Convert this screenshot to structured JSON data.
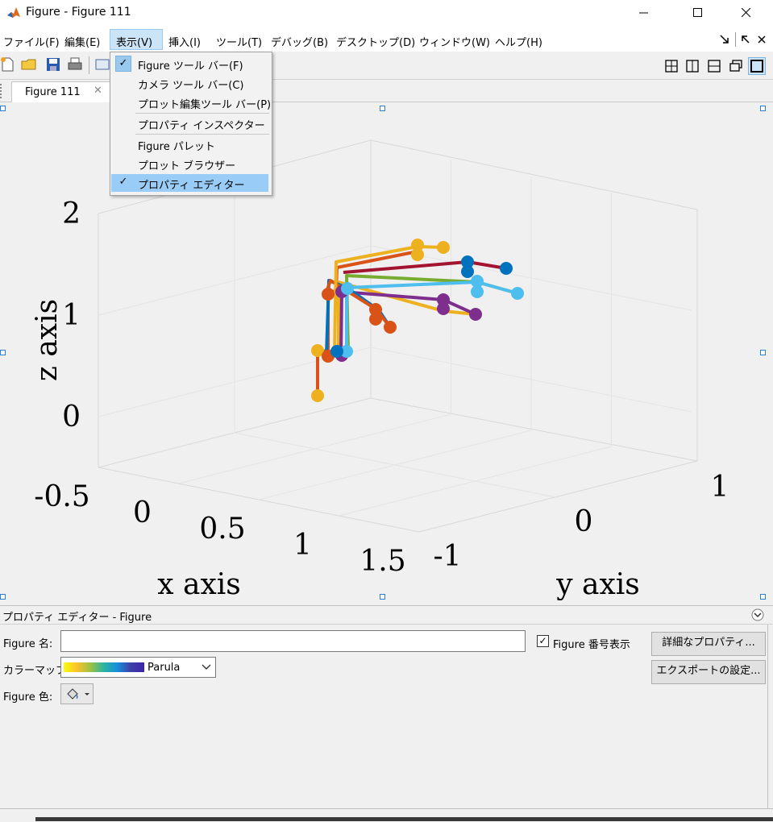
{
  "window": {
    "title": "Figure - Figure 111",
    "minimize_icon": "minimize-icon",
    "maximize_icon": "maximize-icon",
    "close_icon": "close-icon"
  },
  "menubar": {
    "items": [
      "ファイル(F)",
      "編集(E)",
      "表示(V)",
      "挿入(I)",
      "ツール(T)",
      "デバッグ(B)",
      "デスクトップ(D)",
      "ウィンドウ(W)",
      "ヘルプ(H)"
    ],
    "active": "表示(V)"
  },
  "view_menu": {
    "items": [
      {
        "label": "Figure ツール バー(F)",
        "checked": true
      },
      {
        "label": "カメラ ツール バー(C)",
        "checked": false
      },
      {
        "label": "プロット編集ツール バー(P)",
        "checked": false
      },
      {
        "label": "プロパティ インスペクター",
        "checked": false
      },
      {
        "label": "Figure パレット",
        "checked": false
      },
      {
        "label": "プロット ブラウザー",
        "checked": false
      },
      {
        "label": "プロパティ エディター",
        "checked": true
      }
    ]
  },
  "tab": {
    "label": "Figure 111",
    "close": "✕"
  },
  "chart_data": {
    "type": "line",
    "projection": "3d",
    "xlabel": "x axis",
    "ylabel": "y axis",
    "zlabel": "z axis",
    "xticks": [
      "-0.5",
      "0",
      "0.5",
      "1",
      "1.5"
    ],
    "yticks": [
      "-1",
      "0",
      "1"
    ],
    "zticks": [
      "0",
      "1",
      "2"
    ],
    "grid": true,
    "colors": [
      "#0072BD",
      "#D95319",
      "#EDB120",
      "#7E2F8E",
      "#77AC30",
      "#4DBEEE",
      "#A2142F"
    ]
  },
  "property_editor": {
    "title": "プロパティ エディター - Figure",
    "figure_name_label": "Figure 名:",
    "figure_name_value": "",
    "number_title_label": "Figure 番号表示",
    "number_title_checked": true,
    "colormap_label": "カラーマップ:",
    "colormap_value": "Parula",
    "color_label": "Figure 色:",
    "more_props_button": "詳細なプロパティ...",
    "export_button": "エクスポートの設定..."
  }
}
